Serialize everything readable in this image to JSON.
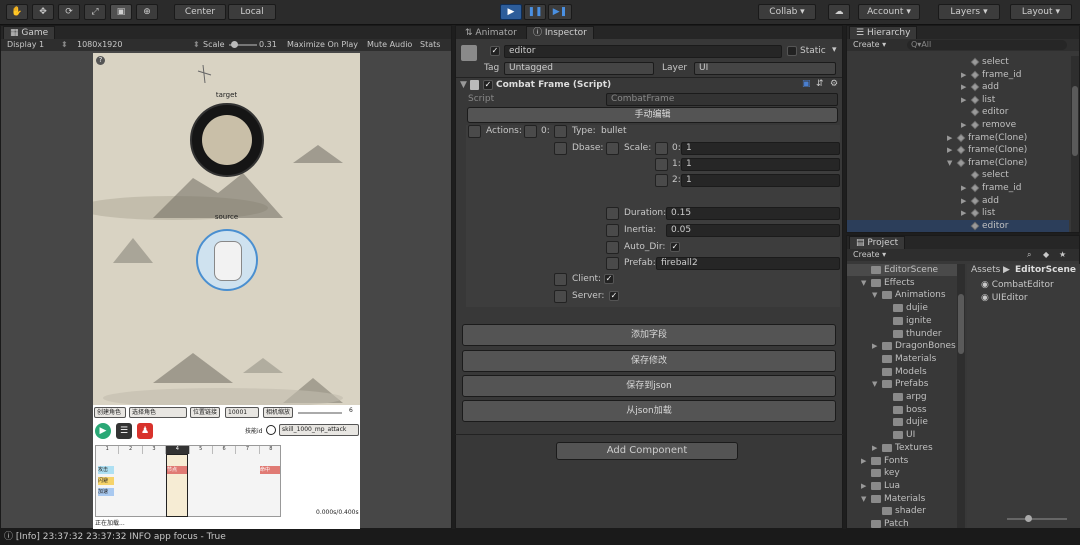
{
  "toolbar": {
    "center": "Center",
    "local": "Local",
    "collab": "Collab ▾",
    "account": "Account",
    "layers": "Layers",
    "layout": "Layout"
  },
  "game": {
    "tab": "Game",
    "display": "Display 1",
    "resolution": "1080x1920",
    "scale_label": "Scale",
    "scale_value": "0.31",
    "maximize": "Maximize On Play",
    "mute": "Mute Audio",
    "stats": "Stats",
    "target_label": "target",
    "source_label": "source",
    "btn_create_role": "创建角色",
    "sel_role": "选择角色",
    "btn_pos_link": "位置链接",
    "id_value": "10001",
    "cam_scale": "相机缩放",
    "slider_value": "6",
    "skill_prefix": "技能id",
    "skill_value": "skill_1000_mp_attack",
    "time_text": "0.000s/0.400s",
    "loading": "正在加载...",
    "timeline_headers": [
      "1",
      "2",
      "3",
      "4",
      "5",
      "6",
      "7",
      "8"
    ],
    "track_labels": [
      "攻击",
      "闪避",
      "加速"
    ],
    "track_tag_left": "节点",
    "track_tag_right": "命中"
  },
  "inspector": {
    "tab_animator": "Animator",
    "tab_inspector": "Inspector",
    "object_name": "editor",
    "static_label": "Static",
    "tag_label": "Tag",
    "tag_value": "Untagged",
    "layer_label": "Layer",
    "layer_value": "UI",
    "component_title": "Combat Frame (Script)",
    "script_label": "Script",
    "script_value": "CombatFrame",
    "manual_edit": "手动编辑",
    "actions_label": "Actions:",
    "actions_index": "0:",
    "type_label": "Type:",
    "type_value": "bullet",
    "dbase_label": "Dbase:",
    "scale_label": "Scale:",
    "scale_rows": [
      {
        "i": "0:",
        "v": "1"
      },
      {
        "i": "1:",
        "v": "1"
      },
      {
        "i": "2:",
        "v": "1"
      }
    ],
    "duration_label": "Duration:",
    "duration_value": "0.15",
    "inertia_label": "Inertia:",
    "inertia_value": "0.05",
    "autodir_label": "Auto_Dir:",
    "prefab_label": "Prefab:",
    "prefab_value": "fireball2",
    "client_label": "Client:",
    "server_label": "Server:",
    "btn_add_field": "添加字段",
    "btn_save": "保存修改",
    "btn_save_json": "保存到json",
    "btn_load_json": "从json加载",
    "add_component": "Add Component"
  },
  "hierarchy": {
    "tab": "Hierarchy",
    "create": "Create ▾",
    "search": "Q▾All",
    "rows": [
      {
        "t": "select",
        "d": 3,
        "e": ""
      },
      {
        "t": "frame_id",
        "d": 3,
        "e": "▶"
      },
      {
        "t": "add",
        "d": 3,
        "e": "▶"
      },
      {
        "t": "list",
        "d": 3,
        "e": "▶"
      },
      {
        "t": "editor",
        "d": 3,
        "e": ""
      },
      {
        "t": "remove",
        "d": 3,
        "e": "▶"
      },
      {
        "t": "frame(Clone)",
        "d": 2,
        "e": "▶"
      },
      {
        "t": "frame(Clone)",
        "d": 2,
        "e": "▶"
      },
      {
        "t": "frame(Clone)",
        "d": 2,
        "e": "▼"
      },
      {
        "t": "select",
        "d": 3,
        "e": ""
      },
      {
        "t": "frame_id",
        "d": 3,
        "e": "▶"
      },
      {
        "t": "add",
        "d": 3,
        "e": "▶"
      },
      {
        "t": "list",
        "d": 3,
        "e": "▶"
      },
      {
        "t": "editor",
        "d": 3,
        "e": "",
        "sel": true
      }
    ]
  },
  "project": {
    "tab": "Project",
    "create": "Create ▾",
    "tree": [
      {
        "t": "EditorScene",
        "d": 0,
        "e": "",
        "sel": true
      },
      {
        "t": "Effects",
        "d": 0,
        "e": "▼"
      },
      {
        "t": "Animations",
        "d": 1,
        "e": "▼"
      },
      {
        "t": "dujie",
        "d": 2,
        "e": ""
      },
      {
        "t": "ignite",
        "d": 2,
        "e": ""
      },
      {
        "t": "thunder",
        "d": 2,
        "e": ""
      },
      {
        "t": "DragonBones",
        "d": 1,
        "e": "▶"
      },
      {
        "t": "Materials",
        "d": 1,
        "e": ""
      },
      {
        "t": "Models",
        "d": 1,
        "e": ""
      },
      {
        "t": "Prefabs",
        "d": 1,
        "e": "▼"
      },
      {
        "t": "arpg",
        "d": 2,
        "e": ""
      },
      {
        "t": "boss",
        "d": 2,
        "e": ""
      },
      {
        "t": "dujie",
        "d": 2,
        "e": ""
      },
      {
        "t": "UI",
        "d": 2,
        "e": ""
      },
      {
        "t": "Textures",
        "d": 1,
        "e": "▶"
      },
      {
        "t": "Fonts",
        "d": 0,
        "e": "▶"
      },
      {
        "t": "key",
        "d": 0,
        "e": ""
      },
      {
        "t": "Lua",
        "d": 0,
        "e": "▶"
      },
      {
        "t": "Materials",
        "d": 0,
        "e": "▼"
      },
      {
        "t": "shader",
        "d": 1,
        "e": ""
      },
      {
        "t": "Patch",
        "d": 0,
        "e": ""
      }
    ],
    "breadcrumb_root": "Assets",
    "breadcrumb_leaf": "EditorScene",
    "files": [
      "CombatEditor",
      "UIEditor"
    ]
  },
  "status": {
    "text": "[Info] 23:37:32 23:37:32 INFO app focus - True"
  }
}
